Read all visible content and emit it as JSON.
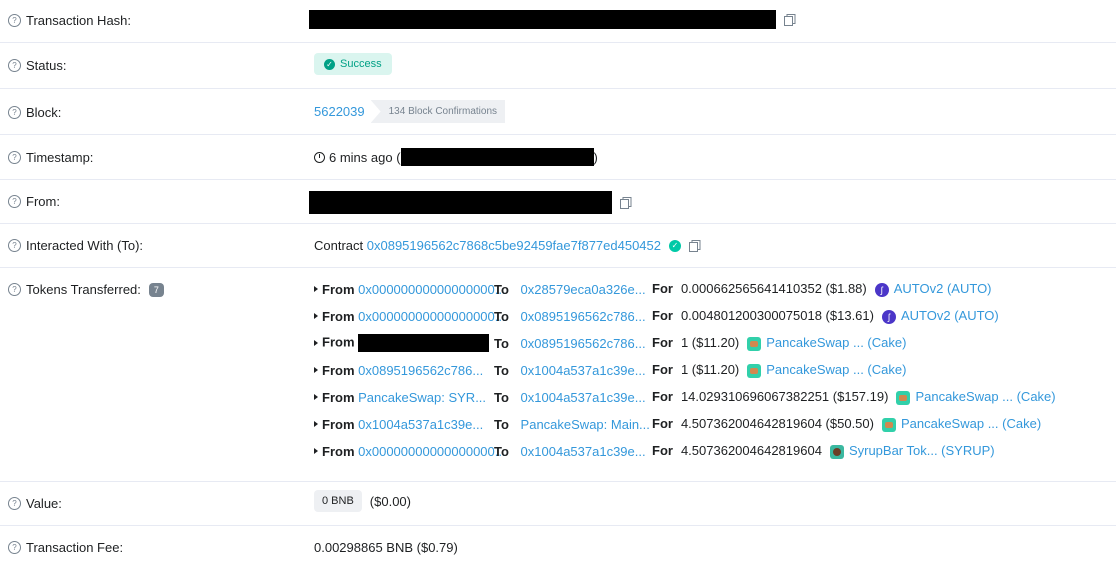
{
  "labels": {
    "tx_hash": "Transaction Hash:",
    "status": "Status:",
    "block": "Block:",
    "timestamp": "Timestamp:",
    "from": "From:",
    "interacted": "Interacted With (To):",
    "tokens": "Tokens Transferred:",
    "value": "Value:",
    "fee": "Transaction Fee:"
  },
  "status": {
    "text": "Success",
    "color": "#00a186"
  },
  "block": {
    "number": "5622039",
    "confirmations": "134 Block Confirmations"
  },
  "timestamp": {
    "relative": "6 mins ago (",
    "close": ")"
  },
  "interacted": {
    "prefix": "Contract",
    "address": "0x0895196562c7868c5be92459fae7f877ed450452"
  },
  "tokens_count": "7",
  "transfers": [
    {
      "from": "0x00000000000000000...",
      "from_redacted": false,
      "to": "0x28579eca0a326e...",
      "amount": "0.000662565641410352 ($1.88)",
      "token": "AUTOv2 (AUTO)",
      "icon": "auto-icon"
    },
    {
      "from": "0x00000000000000000...",
      "from_redacted": false,
      "to": "0x0895196562c786...",
      "amount": "0.004801200300075018 ($13.61)",
      "token": "AUTOv2 (AUTO)",
      "icon": "auto-icon"
    },
    {
      "from": "",
      "from_redacted": true,
      "to": "0x0895196562c786...",
      "amount": "1 ($11.20)",
      "token": "PancakeSwap ... (Cake)",
      "icon": "cake-icon"
    },
    {
      "from": "0x0895196562c786...",
      "from_redacted": false,
      "to": "0x1004a537a1c39e...",
      "amount": "1 ($11.20)",
      "token": "PancakeSwap ... (Cake)",
      "icon": "cake-icon"
    },
    {
      "from": "PancakeSwap: SYR...",
      "from_redacted": false,
      "to": "0x1004a537a1c39e...",
      "amount": "14.029310696067382251 ($157.19)",
      "token": "PancakeSwap ... (Cake)",
      "icon": "cake-icon"
    },
    {
      "from": "0x1004a537a1c39e...",
      "from_redacted": false,
      "to": "PancakeSwap: Main...",
      "amount": "4.507362004642819604 ($50.50)",
      "token": "PancakeSwap ... (Cake)",
      "icon": "cake-icon"
    },
    {
      "from": "0x00000000000000000...",
      "from_redacted": false,
      "to": "0x1004a537a1c39e...",
      "amount": "4.507362004642819604",
      "token": "SyrupBar Tok... (SYRUP)",
      "icon": "syrup-icon"
    }
  ],
  "keywords": {
    "from": "From",
    "to": "To",
    "for": "For"
  },
  "value": {
    "bnb": "0 BNB",
    "usd": "($0.00)"
  },
  "fee": {
    "text": "0.00298865 BNB ($0.79)"
  }
}
